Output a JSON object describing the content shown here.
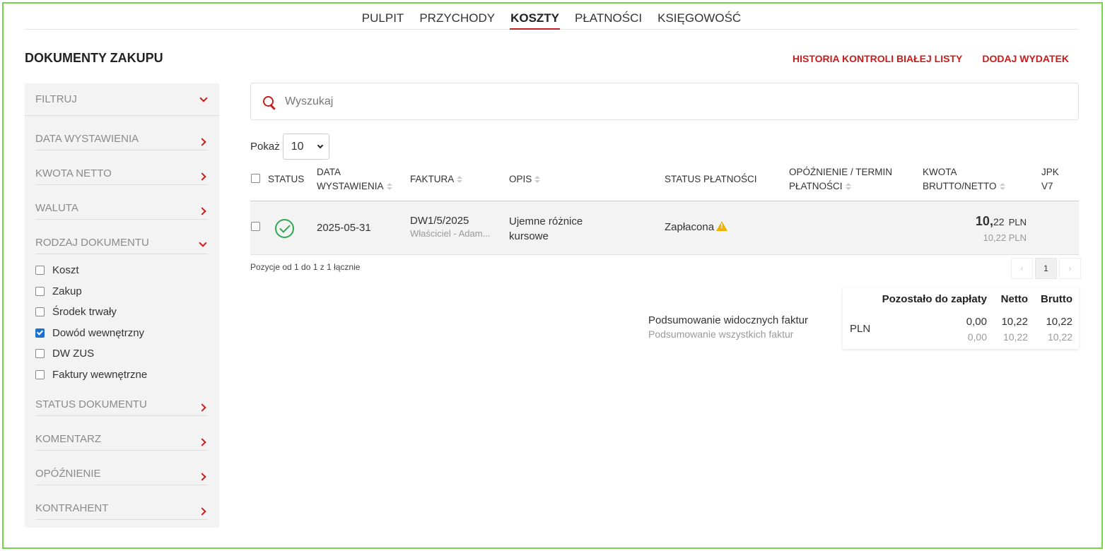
{
  "nav": {
    "tabs": [
      {
        "label": "PULPIT"
      },
      {
        "label": "PRZYCHODY"
      },
      {
        "label": "KOSZTY"
      },
      {
        "label": "PŁATNOŚCI"
      },
      {
        "label": "KSIĘGOWOŚĆ"
      }
    ],
    "active_tab": "KOSZTY"
  },
  "page": {
    "title": "DOKUMENTY ZAKUPU",
    "action_history": "HISTORIA KONTROLI BIAŁEJ LISTY",
    "action_add": "DODAJ WYDATEK"
  },
  "sidebar": {
    "filter_label": "FILTRUJ",
    "sections": {
      "date": "DATA WYSTAWIENIA",
      "net": "KWOTA NETTO",
      "currency": "WALUTA",
      "doc_type": "RODZAJ DOKUMENTU",
      "doc_status": "STATUS DOKUMENTU",
      "comment": "KOMENTARZ",
      "delay": "OPÓŹNIENIE",
      "contractor": "KONTRAHENT"
    },
    "doc_types": [
      {
        "label": "Koszt",
        "checked": false
      },
      {
        "label": "Zakup",
        "checked": false
      },
      {
        "label": "Środek trwały",
        "checked": false
      },
      {
        "label": "Dowód wewnętrzny",
        "checked": true
      },
      {
        "label": "DW ZUS",
        "checked": false
      },
      {
        "label": "Faktury wewnętrzne",
        "checked": false
      }
    ]
  },
  "search": {
    "placeholder": "Wyszukaj"
  },
  "show": {
    "label": "Pokaż",
    "value": "10"
  },
  "table": {
    "headers": {
      "status": "STATUS",
      "date_1": "DATA",
      "date_2": "WYSTAWIENIA",
      "invoice": "FAKTURA",
      "desc": "OPIS",
      "pay_status": "STATUS PŁATNOŚCI",
      "delay_1": "OPÓŹNIENIE / TERMIN",
      "delay_2": "PŁATNOŚCI",
      "amount_1": "KWOTA",
      "amount_2": "BRUTTO/NETTO",
      "jpk_1": "JPK",
      "jpk_2": "V7"
    },
    "rows": [
      {
        "date": "2025-05-31",
        "invoice": "DW1/5/2025",
        "invoice_sub": "Właściciel - Adam...",
        "desc_1": "Ujemne różnice",
        "desc_2": "kursowe",
        "pay_status": "Zapłacona",
        "gross_int": "10,",
        "gross_dec": "22",
        "currency": "PLN",
        "net": "10,22 PLN"
      }
    ]
  },
  "pagination": {
    "info": "Pozycje od 1 do 1 z 1 łącznie",
    "current": "1",
    "prev": "‹",
    "next": "›"
  },
  "summary": {
    "visible_label": "Podsumowanie widocznych faktur",
    "all_label": "Podsumowanie wszystkich faktur",
    "col_remaining": "Pozostało do zapłaty",
    "col_net": "Netto",
    "col_gross": "Brutto",
    "currency": "PLN",
    "visible": {
      "remaining": "0,00",
      "net": "10,22",
      "gross": "10,22"
    },
    "all": {
      "remaining": "0,00",
      "net": "10,22",
      "gross": "10,22"
    }
  },
  "colors": {
    "accent": "#c71d1d",
    "success": "#2fa84f",
    "warning": "#f0b000",
    "frame": "#77d44a"
  }
}
